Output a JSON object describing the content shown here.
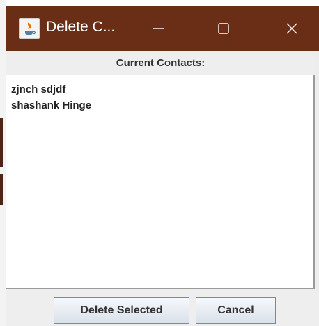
{
  "window": {
    "title": "Delete C...",
    "controls": {
      "minimize": "minimize-icon",
      "maximize": "maximize-icon",
      "close": "close-icon"
    },
    "titlebar_color": "#6a2e16"
  },
  "header": {
    "label": "Current Contacts:"
  },
  "contacts": [
    "zjnch sdjdf",
    "shashank Hinge"
  ],
  "buttons": {
    "delete_label": "Delete Selected",
    "cancel_label": "Cancel"
  }
}
